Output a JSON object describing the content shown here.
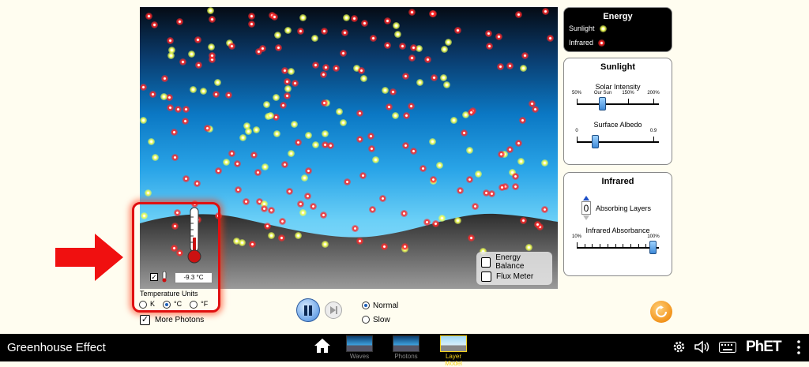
{
  "app": {
    "title": "Greenhouse Effect"
  },
  "overlay": {
    "energy_balance": "Energy Balance",
    "flux_meter": "Flux Meter"
  },
  "thermometer": {
    "readout": "-9.3 °C",
    "units_title": "Temperature Units",
    "units": [
      "K",
      "°C",
      "°F"
    ],
    "selected_unit": "°C"
  },
  "more_photons": "More Photons",
  "playback": {
    "speeds": [
      "Normal",
      "Slow"
    ],
    "selected_speed": "Normal"
  },
  "energy_panel": {
    "title": "Energy",
    "sunlight": "Sunlight",
    "infrared": "Infrared"
  },
  "sunlight_panel": {
    "title": "Sunlight",
    "solar_intensity": {
      "label": "Solar Intensity",
      "ticks": [
        "50%",
        "Our Sun",
        "150%",
        "200%"
      ],
      "value_percent": 100
    },
    "surface_albedo": {
      "label": "Surface Albedo",
      "ticks": [
        "0",
        "0.9"
      ],
      "value": 0.2
    }
  },
  "infrared_panel": {
    "title": "Infrared",
    "absorbing_layers": {
      "value": "0",
      "label": "Absorbing Layers"
    },
    "infrared_absorbance": {
      "label": "Infrared Absorbance",
      "ticks": [
        "10%",
        "100%"
      ],
      "value_percent": 100
    }
  },
  "navbar": {
    "screens": [
      "Waves",
      "Photons",
      "Layer Model"
    ],
    "active_screen": "Layer Model"
  },
  "colors": {
    "annotation_red": "#e01010",
    "infrared_photon": "#ff2a2a",
    "sunlight_photon": "#f4ff5a",
    "active_tab": "#f5d21c",
    "reset": "#f2941c"
  }
}
